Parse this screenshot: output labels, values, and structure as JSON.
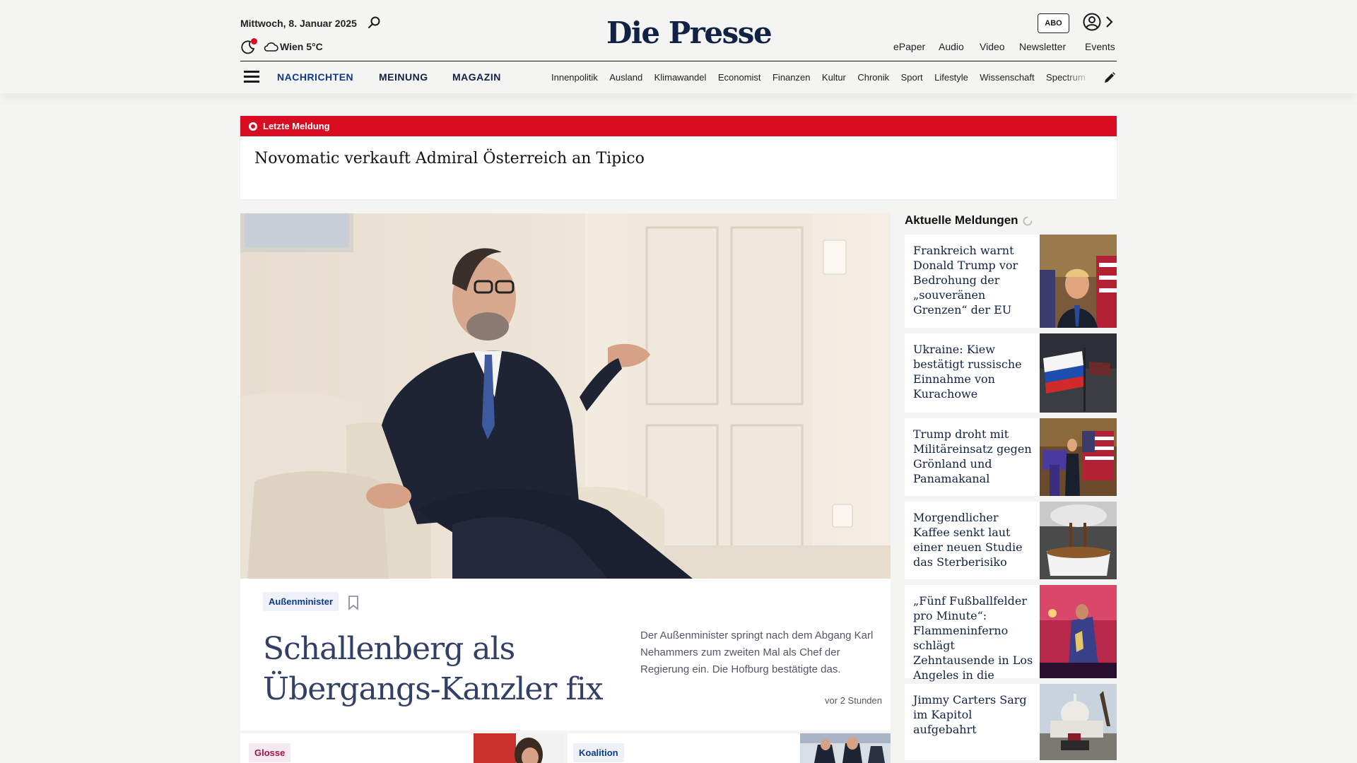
{
  "header": {
    "date": "Mittwoch, 8. Januar 2025",
    "weather": "Wien 5°C",
    "logo": "Die Presse",
    "abo_label": "ABO",
    "top_links": [
      "ePaper",
      "Audio",
      "Video",
      "Newsletter",
      "Events"
    ],
    "main_nav": [
      "NACHRICHTEN",
      "MEINUNG",
      "MAGAZIN"
    ],
    "sub_nav": [
      "Innenpolitik",
      "Ausland",
      "Klimawandel",
      "Economist",
      "Finanzen",
      "Kultur",
      "Chronik",
      "Sport",
      "Lifestyle",
      "Wissenschaft",
      "Spectrum"
    ]
  },
  "breaking": {
    "label": "Letzte Meldung",
    "headline": "Novomatic verkauft Admiral Österreich an Tipico"
  },
  "lead": {
    "category": "Außenminister",
    "title": "Schallenberg als Übergangs-Kanzler fix",
    "teaser": "Der Außenminister springt nach dem Abgang Karl Nehammers zum zweiten Mal als Chef der Regierung ein. Die Hofburg bestätigte das.",
    "time": "vor 2 Stunden"
  },
  "aktuell": {
    "title": "Aktuelle Meldungen",
    "items": [
      "Frankreich warnt Donald Trump vor Bedrohung der „souveränen Grenzen“ der EU",
      "Ukraine: Kiew bestätigt russische Einnahme von Kurachowe",
      "Trump droht mit Militäreinsatz gegen Grönland und Panamakanal",
      "Morgendlicher Kaffee senkt laut einer neuen Studie das Sterberisiko",
      "„Fünf Fußballfelder pro Minute“: Flammeninferno schlägt Zehntausende in Los Angeles in die Flucht",
      "Jimmy Carters Sarg im Kapitol aufgebahrt"
    ]
  },
  "bottom": {
    "cards": [
      "Glosse",
      "Koalition"
    ]
  },
  "colors": {
    "brand": "#112244",
    "breaking_red": "#d90d22",
    "nav_blue": "#0d3b8a",
    "background": "#f4f4f2"
  }
}
